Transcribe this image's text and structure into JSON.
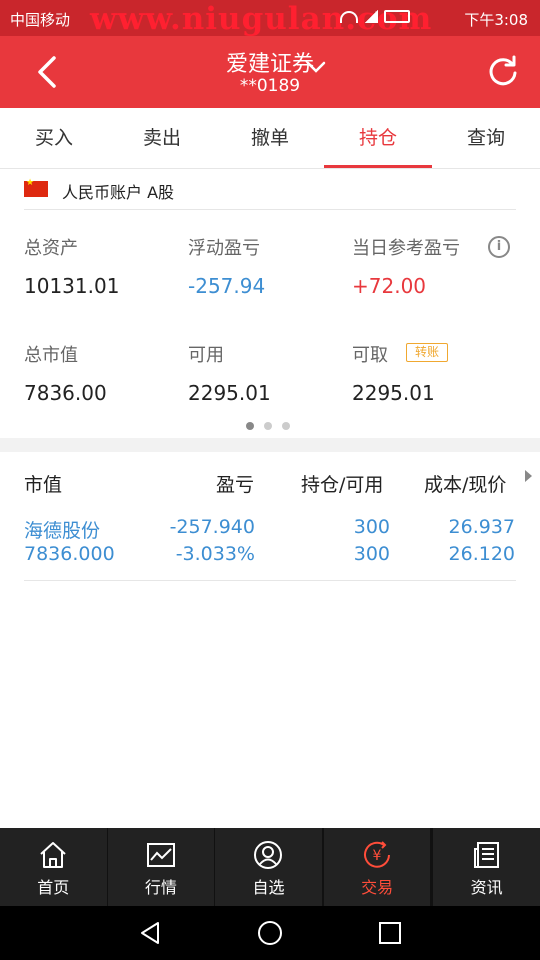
{
  "status_bar": {
    "carrier": "中国移动",
    "watermark": "www.niugulan.com",
    "time": "下午3:08"
  },
  "header": {
    "title": "爱建证券",
    "account_masked": "**0189"
  },
  "tabs": [
    {
      "label": "买入",
      "active": false
    },
    {
      "label": "卖出",
      "active": false
    },
    {
      "label": "撤单",
      "active": false
    },
    {
      "label": "持仓",
      "active": true
    },
    {
      "label": "查询",
      "active": false
    }
  ],
  "account": {
    "label": "人民币账户 A股",
    "flag": "china-flag"
  },
  "summary": {
    "total_assets": {
      "label": "总资产",
      "value": "10131.01"
    },
    "floating_pl": {
      "label": "浮动盈亏",
      "value": "-257.94"
    },
    "today_pl": {
      "label": "当日参考盈亏",
      "value": "+72.00"
    },
    "market_value": {
      "label": "总市值",
      "value": "7836.00"
    },
    "available": {
      "label": "可用",
      "value": "2295.01"
    },
    "withdrawable": {
      "label": "可取",
      "value": "2295.01",
      "transfer_label": "转账"
    }
  },
  "positions": {
    "headers": {
      "market_value": "市值",
      "pl": "盈亏",
      "holding": "持仓/可用",
      "cost_price": "成本/现价"
    },
    "rows": [
      {
        "name": "海德股份",
        "market_value": "7836.000",
        "pl": "-257.940",
        "pl_pct": "-3.033%",
        "holding": "300",
        "available": "300",
        "cost": "26.937",
        "price": "26.120"
      }
    ]
  },
  "bottom_nav": [
    {
      "label": "首页",
      "icon": "home-icon",
      "active": false
    },
    {
      "label": "行情",
      "icon": "chart-icon",
      "active": false
    },
    {
      "label": "自选",
      "icon": "user-icon",
      "active": false
    },
    {
      "label": "交易",
      "icon": "yuan-icon",
      "active": true
    },
    {
      "label": "资讯",
      "icon": "news-icon",
      "active": false
    }
  ],
  "colors": {
    "brand_red": "#e8383d",
    "status_red": "#c9262c",
    "loss_blue": "#3d8ed2",
    "nav_active": "#ff4d3a",
    "nav_bg": "#222222",
    "transfer_orange": "#f0a830"
  }
}
